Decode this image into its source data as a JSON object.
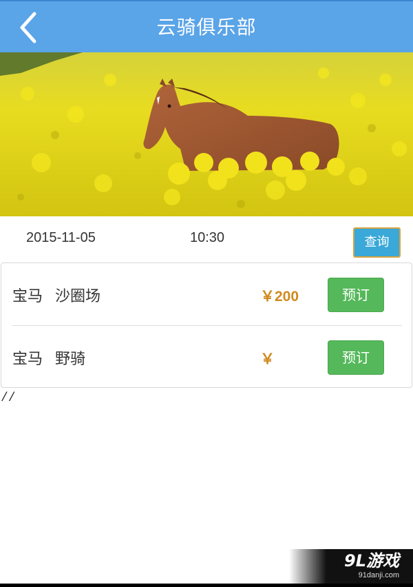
{
  "header": {
    "title": "云骑俱乐部",
    "back_icon": "chevron-left-icon",
    "background_color": "#5aa4e8"
  },
  "banner": {
    "content": "horse running through yellow rapeseed field"
  },
  "query": {
    "date": "2015-11-05",
    "time": "10:30",
    "button_label": "查询",
    "button_color": "#3aa8d8"
  },
  "items": [
    {
      "horse": "宝马",
      "venue": "沙圈场",
      "price": "￥200",
      "button_label": "预订"
    },
    {
      "horse": "宝马",
      "venue": "野骑",
      "price": "￥",
      "button_label": "预订"
    }
  ],
  "stray_text": "//",
  "watermark": {
    "brand": "9L游戏",
    "url": "91danji.com"
  },
  "colors": {
    "price": "#d08a1e",
    "book_button": "#55b85a"
  }
}
